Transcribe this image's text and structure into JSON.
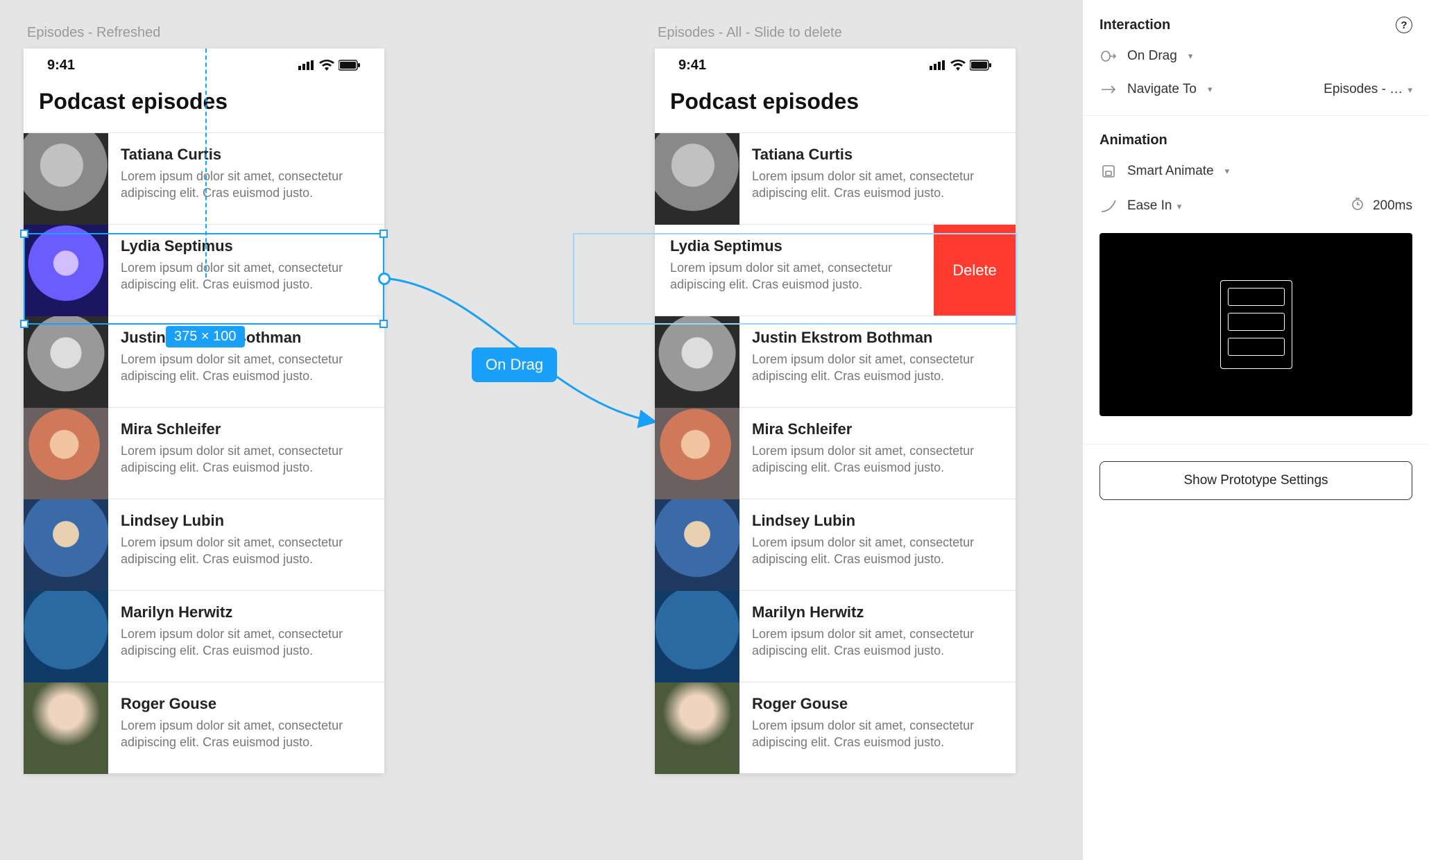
{
  "canvas": {
    "frame_a_label": "Episodes - Refreshed",
    "frame_b_label": "Episodes - All - Slide to delete",
    "selection_dim": "375 × 100",
    "trigger_label": "On Drag"
  },
  "phone": {
    "time": "9:41",
    "title": "Podcast episodes",
    "desc": "Lorem ipsum dolor sit amet, consectetur adipiscing elit. Cras euismod justo.",
    "delete_label": "Delete",
    "rows": [
      {
        "name": "Tatiana Curtis"
      },
      {
        "name": "Lydia Septimus"
      },
      {
        "name": "Justin Ekstrom Bothman"
      },
      {
        "name": "Mira Schleifer"
      },
      {
        "name": "Lindsey Lubin"
      },
      {
        "name": "Marilyn Herwitz"
      },
      {
        "name": "Roger Gouse"
      }
    ]
  },
  "inspector": {
    "interaction_title": "Interaction",
    "trigger": "On Drag",
    "action": "Navigate To",
    "destination": "Episodes - …",
    "animation_title": "Animation",
    "anim_type": "Smart Animate",
    "easing": "Ease In",
    "duration": "200ms",
    "proto_settings_btn": "Show Prototype Settings"
  }
}
